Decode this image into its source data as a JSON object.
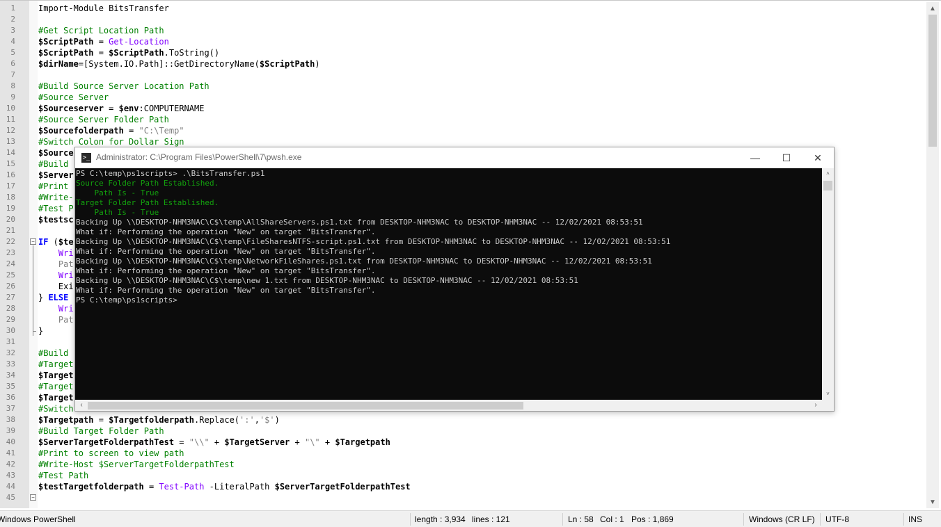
{
  "editor": {
    "lines": [
      {
        "n": "1",
        "segs": [
          {
            "t": "Import-Module BitsTransfer",
            "c": "plain"
          }
        ]
      },
      {
        "n": "2",
        "segs": []
      },
      {
        "n": "3",
        "segs": [
          {
            "t": "#Get Script Location Path",
            "c": "comment"
          }
        ]
      },
      {
        "n": "4",
        "segs": [
          {
            "t": "$ScriptPath",
            "c": "var"
          },
          {
            "t": " = ",
            "c": "plain"
          },
          {
            "t": "Get-Location",
            "c": "cmd"
          }
        ]
      },
      {
        "n": "5",
        "segs": [
          {
            "t": "$ScriptPath",
            "c": "var"
          },
          {
            "t": " = ",
            "c": "plain"
          },
          {
            "t": "$ScriptPath",
            "c": "var"
          },
          {
            "t": ".ToString()",
            "c": "plain"
          }
        ]
      },
      {
        "n": "6",
        "segs": [
          {
            "t": "$dirName",
            "c": "var"
          },
          {
            "t": "=[System.IO.Path]::GetDirectoryName(",
            "c": "plain"
          },
          {
            "t": "$ScriptPath",
            "c": "var"
          },
          {
            "t": ")",
            "c": "plain"
          }
        ]
      },
      {
        "n": "7",
        "segs": []
      },
      {
        "n": "8",
        "segs": [
          {
            "t": "#Build Source Server Location Path",
            "c": "comment"
          }
        ]
      },
      {
        "n": "9",
        "segs": [
          {
            "t": "#Source Server",
            "c": "comment"
          }
        ]
      },
      {
        "n": "10",
        "segs": [
          {
            "t": "$Sourceserver",
            "c": "var"
          },
          {
            "t": " = ",
            "c": "plain"
          },
          {
            "t": "$env",
            "c": "var"
          },
          {
            "t": ":COMPUTERNAME",
            "c": "plain"
          }
        ]
      },
      {
        "n": "11",
        "segs": [
          {
            "t": "#Source Server Folder Path",
            "c": "comment"
          }
        ]
      },
      {
        "n": "12",
        "segs": [
          {
            "t": "$Sourcefolderpath",
            "c": "var"
          },
          {
            "t": " = ",
            "c": "plain"
          },
          {
            "t": "\"C:\\Temp\"",
            "c": "str"
          }
        ]
      },
      {
        "n": "13",
        "segs": [
          {
            "t": "#Switch Colon for Dollar Sign",
            "c": "comment"
          }
        ]
      },
      {
        "n": "14",
        "segs": [
          {
            "t": "$Source",
            "c": "var"
          }
        ]
      },
      {
        "n": "15",
        "segs": [
          {
            "t": "#Build",
            "c": "comment"
          }
        ]
      },
      {
        "n": "16",
        "segs": [
          {
            "t": "$Server",
            "c": "var"
          }
        ]
      },
      {
        "n": "17",
        "segs": [
          {
            "t": "#Print",
            "c": "comment"
          }
        ]
      },
      {
        "n": "18",
        "segs": [
          {
            "t": "#Write-",
            "c": "comment"
          }
        ]
      },
      {
        "n": "19",
        "segs": [
          {
            "t": "#Test P",
            "c": "comment"
          }
        ]
      },
      {
        "n": "20",
        "segs": [
          {
            "t": "$testsc",
            "c": "var"
          }
        ]
      },
      {
        "n": "21",
        "segs": []
      },
      {
        "n": "22",
        "segs": [
          {
            "t": "IF",
            "c": "kw"
          },
          {
            "t": " (",
            "c": "plain"
          },
          {
            "t": "$te",
            "c": "var"
          }
        ]
      },
      {
        "n": "23",
        "segs": [
          {
            "t": "    Wri",
            "c": "cmd"
          }
        ]
      },
      {
        "n": "24",
        "segs": [
          {
            "t": "    Pat",
            "c": "str"
          }
        ]
      },
      {
        "n": "25",
        "segs": [
          {
            "t": "    Wri",
            "c": "cmd"
          }
        ]
      },
      {
        "n": "26",
        "segs": [
          {
            "t": "    Exi",
            "c": "plain"
          }
        ]
      },
      {
        "n": "27",
        "segs": [
          {
            "t": "} ",
            "c": "plain"
          },
          {
            "t": "ELSE",
            "c": "kw"
          }
        ]
      },
      {
        "n": "28",
        "segs": [
          {
            "t": "    Wri",
            "c": "cmd"
          }
        ]
      },
      {
        "n": "29",
        "segs": [
          {
            "t": "    Pat",
            "c": "str"
          }
        ]
      },
      {
        "n": "30",
        "segs": [
          {
            "t": "}",
            "c": "plain"
          }
        ]
      },
      {
        "n": "31",
        "segs": []
      },
      {
        "n": "32",
        "segs": [
          {
            "t": "#Build",
            "c": "comment"
          }
        ]
      },
      {
        "n": "33",
        "segs": [
          {
            "t": "#Target",
            "c": "comment"
          }
        ]
      },
      {
        "n": "34",
        "segs": [
          {
            "t": "$Target",
            "c": "var"
          }
        ]
      },
      {
        "n": "35",
        "segs": [
          {
            "t": "#Target",
            "c": "comment"
          }
        ]
      },
      {
        "n": "36",
        "segs": [
          {
            "t": "$Target",
            "c": "var"
          }
        ]
      },
      {
        "n": "37",
        "segs": [
          {
            "t": "#Switch",
            "c": "comment"
          }
        ]
      },
      {
        "n": "38",
        "segs": [
          {
            "t": "$Targetpath",
            "c": "var"
          },
          {
            "t": " = ",
            "c": "plain"
          },
          {
            "t": "$Targetfolderpath",
            "c": "var"
          },
          {
            "t": ".Replace(",
            "c": "plain"
          },
          {
            "t": "':'",
            "c": "str"
          },
          {
            "t": ",",
            "c": "plain"
          },
          {
            "t": "'$'",
            "c": "str"
          },
          {
            "t": ")",
            "c": "plain"
          }
        ]
      },
      {
        "n": "39",
        "segs": [
          {
            "t": "#Build Target Folder Path",
            "c": "comment"
          }
        ]
      },
      {
        "n": "40",
        "segs": [
          {
            "t": "$ServerTargetFolderpathTest",
            "c": "var"
          },
          {
            "t": " = ",
            "c": "plain"
          },
          {
            "t": "\"\\\\\"",
            "c": "str"
          },
          {
            "t": " + ",
            "c": "plain"
          },
          {
            "t": "$TargetServer",
            "c": "var"
          },
          {
            "t": " + ",
            "c": "plain"
          },
          {
            "t": "\"\\\"",
            "c": "str"
          },
          {
            "t": " + ",
            "c": "plain"
          },
          {
            "t": "$Targetpath",
            "c": "var"
          }
        ]
      },
      {
        "n": "41",
        "segs": [
          {
            "t": "#Print to screen to view path",
            "c": "comment"
          }
        ]
      },
      {
        "n": "42",
        "segs": [
          {
            "t": "#Write-Host $ServerTargetFolderpathTest",
            "c": "comment"
          }
        ]
      },
      {
        "n": "43",
        "segs": [
          {
            "t": "#Test Path",
            "c": "comment"
          }
        ]
      },
      {
        "n": "44",
        "segs": [
          {
            "t": "$testTargetfolderpath",
            "c": "var"
          },
          {
            "t": " = ",
            "c": "plain"
          },
          {
            "t": "Test-Path",
            "c": "cmd"
          },
          {
            "t": " -LiteralPath ",
            "c": "plain"
          },
          {
            "t": "$ServerTargetFolderpathTest",
            "c": "var"
          }
        ]
      },
      {
        "n": "45",
        "segs": []
      }
    ]
  },
  "statusbar": {
    "language": "Windows PowerShell",
    "length": "length : 3,934",
    "lines": "lines : 121",
    "ln": "Ln : 58",
    "col": "Col : 1",
    "pos": "Pos : 1,869",
    "eol": "Windows (CR LF)",
    "encoding": "UTF-8",
    "mode": "INS"
  },
  "terminal": {
    "title": "Administrator: C:\\Program Files\\PowerShell\\7\\pwsh.exe",
    "icon_label": ">_",
    "minimize_glyph": "—",
    "maximize_glyph": "☐",
    "close_glyph": "✕",
    "lines": [
      {
        "text": "PS C:\\temp\\ps1scripts> .\\BitsTransfer.ps1",
        "color": "gray"
      },
      {
        "text": "Source Folder Path Established.",
        "color": "green"
      },
      {
        "text": "    Path Is - True",
        "color": "green"
      },
      {
        "text": "Target Folder Path Established.",
        "color": "green"
      },
      {
        "text": "    Path Is - True",
        "color": "green"
      },
      {
        "text": "Backing Up \\\\DESKTOP-NHM3NAC\\C$\\temp\\AllShareServers.ps1.txt from DESKTOP-NHM3NAC to DESKTOP-NHM3NAC -- 12/02/2021 08:53:51",
        "color": "gray"
      },
      {
        "text": "What if: Performing the operation \"New\" on target \"BitsTransfer\".",
        "color": "gray"
      },
      {
        "text": "Backing Up \\\\DESKTOP-NHM3NAC\\C$\\temp\\FileSharesNTFS-script.ps1.txt from DESKTOP-NHM3NAC to DESKTOP-NHM3NAC -- 12/02/2021 08:53:51",
        "color": "gray"
      },
      {
        "text": "What if: Performing the operation \"New\" on target \"BitsTransfer\".",
        "color": "gray"
      },
      {
        "text": "Backing Up \\\\DESKTOP-NHM3NAC\\C$\\temp\\NetworkFileShares.ps1.txt from DESKTOP-NHM3NAC to DESKTOP-NHM3NAC -- 12/02/2021 08:53:51",
        "color": "gray"
      },
      {
        "text": "What if: Performing the operation \"New\" on target \"BitsTransfer\".",
        "color": "gray"
      },
      {
        "text": "Backing Up \\\\DESKTOP-NHM3NAC\\C$\\temp\\new 1.txt from DESKTOP-NHM3NAC to DESKTOP-NHM3NAC -- 12/02/2021 08:53:51",
        "color": "gray"
      },
      {
        "text": "What if: Performing the operation \"New\" on target \"BitsTransfer\".",
        "color": "gray"
      },
      {
        "text": "PS C:\\temp\\ps1scripts>",
        "color": "gray"
      }
    ]
  },
  "colors": {
    "terminal_bg": "#0c0c0c",
    "terminal_text": "#cccccc",
    "terminal_green": "#13a10e",
    "comment": "#008000",
    "cmdlet": "#8000ff",
    "keyword": "#0000ff"
  }
}
